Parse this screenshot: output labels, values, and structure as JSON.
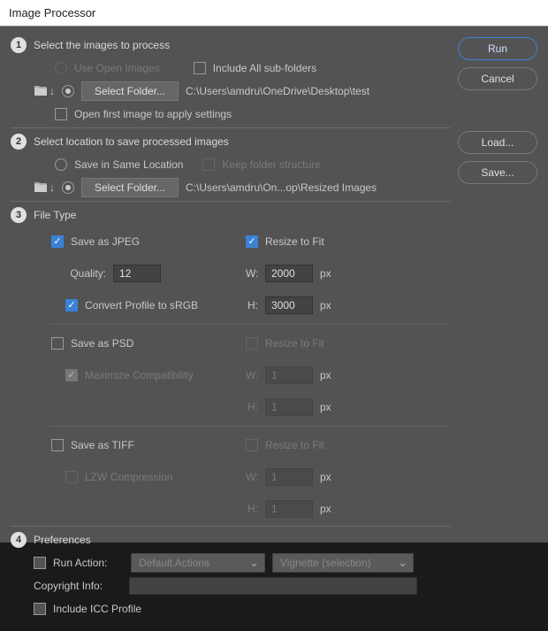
{
  "title": "Image Processor",
  "buttons": {
    "run": "Run",
    "cancel": "Cancel",
    "load": "Load...",
    "save": "Save..."
  },
  "sec1": {
    "num": "1",
    "heading": "Select the images to process",
    "use_open_images": "Use Open Images",
    "include_subfolders": "Include All sub-folders",
    "select_folder": "Select Folder...",
    "source_path": "C:\\Users\\amdru\\OneDrive\\Desktop\\test",
    "open_first": "Open first image to apply settings"
  },
  "sec2": {
    "num": "2",
    "heading": "Select location to save processed images",
    "save_same": "Save in Same Location",
    "keep_structure": "Keep folder structure",
    "select_folder": "Select Folder...",
    "dest_path": "C:\\Users\\amdru\\On...op\\Resized Images"
  },
  "sec3": {
    "num": "3",
    "heading": "File Type",
    "jpeg": {
      "label": "Save as JPEG",
      "resize_label": "Resize to Fit",
      "quality_label": "Quality:",
      "quality_value": "12",
      "convert_srgb": "Convert Profile to sRGB",
      "w_label": "W:",
      "w_value": "2000",
      "h_label": "H:",
      "h_value": "3000",
      "px": "px"
    },
    "psd": {
      "label": "Save as PSD",
      "resize_label": "Resize to Fit",
      "max_compat": "Maximize Compatibility",
      "w_label": "W:",
      "w_value": "1",
      "h_label": "H:",
      "h_value": "1",
      "px": "px"
    },
    "tiff": {
      "label": "Save as TIFF",
      "resize_label": "Resize to Fit",
      "lzw": "LZW Compression",
      "w_label": "W:",
      "w_value": "1",
      "h_label": "H:",
      "h_value": "1",
      "px": "px"
    }
  },
  "sec4": {
    "num": "4",
    "heading": "Preferences",
    "run_action": "Run Action:",
    "action_set": "Default Actions",
    "action_name": "Vignette (selection)",
    "copyright_label": "Copyright Info:",
    "copyright_value": "",
    "include_icc": "Include ICC Profile"
  }
}
